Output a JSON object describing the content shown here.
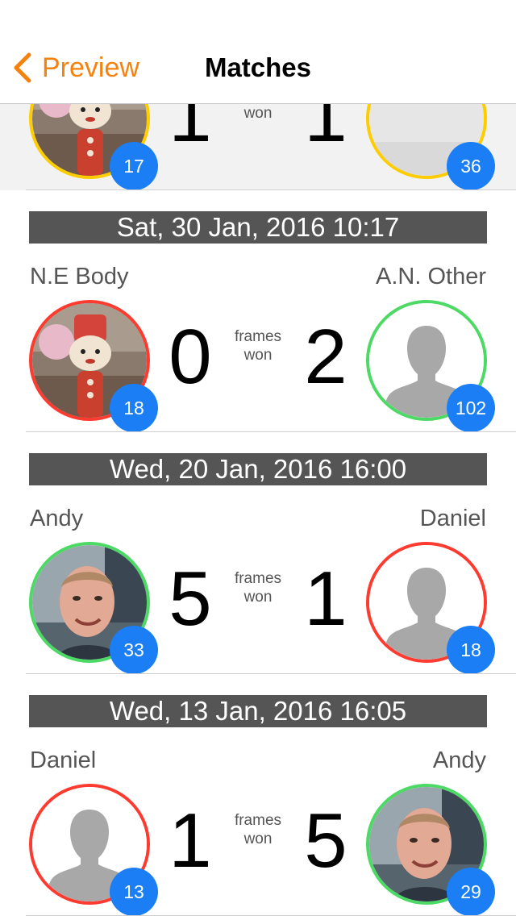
{
  "nav": {
    "back_label": "Preview",
    "title": "Matches"
  },
  "colors": {
    "accent": "#f5820e",
    "win_ring": "#4cd964",
    "loss_ring": "#ff3b30",
    "draw_ring": "#ffcc00",
    "badge": "#1b7ef4",
    "date_bar": "#555555"
  },
  "frames_label_line1": "frames",
  "frames_label_line2": "won",
  "matches": [
    {
      "date": "",
      "left": {
        "name": "",
        "score": "1",
        "badge": "17",
        "ring": "#ffcc00",
        "avatar": "doll-photo"
      },
      "right": {
        "name": "",
        "score": "1",
        "badge": "36",
        "ring": "#ffcc00",
        "avatar": "grey-photo"
      }
    },
    {
      "date": "Sat, 30 Jan, 2016 10:17",
      "left": {
        "name": "N.E Body",
        "score": "0",
        "badge": "18",
        "ring": "#ff3b30",
        "avatar": "doll-photo"
      },
      "right": {
        "name": "A.N. Other",
        "score": "2",
        "badge": "102",
        "ring": "#4cd964",
        "avatar": "placeholder-silhouette"
      }
    },
    {
      "date": "Wed, 20 Jan, 2016 16:00",
      "left": {
        "name": "Andy",
        "score": "5",
        "badge": "33",
        "ring": "#4cd964",
        "avatar": "face-photo"
      },
      "right": {
        "name": "Daniel",
        "score": "1",
        "badge": "18",
        "ring": "#ff3b30",
        "avatar": "placeholder-silhouette"
      }
    },
    {
      "date": "Wed, 13 Jan, 2016 16:05",
      "left": {
        "name": "Daniel",
        "score": "1",
        "badge": "13",
        "ring": "#ff3b30",
        "avatar": "placeholder-silhouette"
      },
      "right": {
        "name": "Andy",
        "score": "5",
        "badge": "29",
        "ring": "#4cd964",
        "avatar": "face-photo"
      }
    }
  ]
}
